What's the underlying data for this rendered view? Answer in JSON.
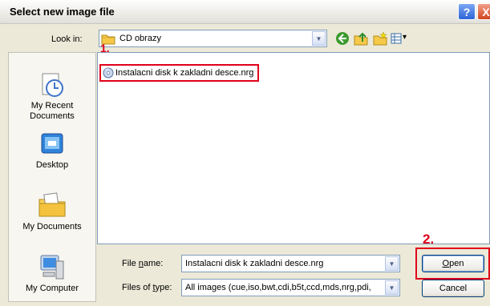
{
  "window": {
    "title": "Select new image file",
    "help_glyph": "?",
    "close_glyph": "X"
  },
  "lookin": {
    "label": "Look in:",
    "value": "CD obrazy",
    "arrow": "▼"
  },
  "toolbar": {
    "view_arrow": "▾"
  },
  "places": [
    {
      "label": "My Recent Documents"
    },
    {
      "label": "Desktop"
    },
    {
      "label": "My Documents"
    },
    {
      "label": "My Computer"
    }
  ],
  "files": [
    {
      "name": "Instalacni disk k zakladni desce.nrg"
    }
  ],
  "steps": {
    "one": "1.",
    "two": "2."
  },
  "filename": {
    "label_prefix": "File ",
    "label_mnemonic": "n",
    "label_suffix": "ame:",
    "value": "Instalacni disk k zakladni desce.nrg"
  },
  "filetype": {
    "label_prefix": "Files of ",
    "label_mnemonic": "t",
    "label_suffix": "ype:",
    "value": "All images (cue,iso,bwt,cdi,b5t,ccd,mds,nrg,pdi,"
  },
  "buttons": {
    "open_mnemonic": "O",
    "open_rest": "pen",
    "cancel": "Cancel"
  },
  "colors": {
    "highlight": "#e0001b",
    "titlebar": "#ecebe6",
    "dialog": "#ece9d8"
  }
}
